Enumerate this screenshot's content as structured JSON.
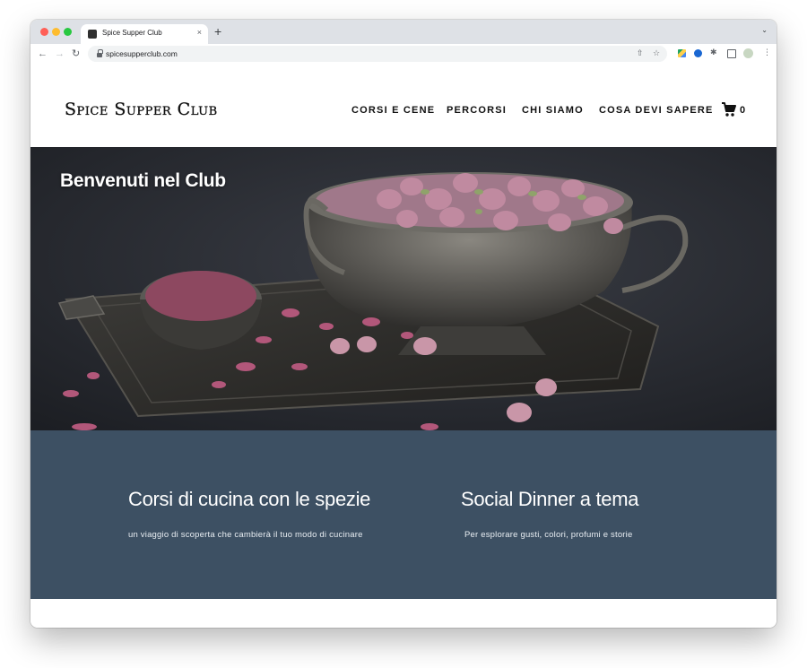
{
  "browser": {
    "tab_title": "Spice Supper Club",
    "tab_close": "×",
    "new_tab": "+",
    "tab_menu": "⌄",
    "url": "spicesupperclub.com",
    "back": "←",
    "forward": "→",
    "reload": "↻",
    "share": "⇧",
    "bookmark": "☆",
    "extensions": "✱",
    "more": "⋮"
  },
  "site": {
    "logo": "Spice Supper Club",
    "nav": [
      "CORSI E CENE",
      "PERCORSI",
      "CHI SIAMO",
      "COSA DEVI SAPERE"
    ],
    "cart_count": "0"
  },
  "hero": {
    "title": "Benvenuti nel Club"
  },
  "features": [
    {
      "title": "Corsi di cucina con le spezie",
      "subtitle": "un viaggio di scoperta che cambierà il tuo modo di cucinare"
    },
    {
      "title": "Social Dinner a tema",
      "subtitle": "Per esplorare gusti, colori, profumi e storie"
    }
  ],
  "colors": {
    "band": "#3d5063",
    "hero_background": "#272a30",
    "rose": "#c88aa0"
  }
}
